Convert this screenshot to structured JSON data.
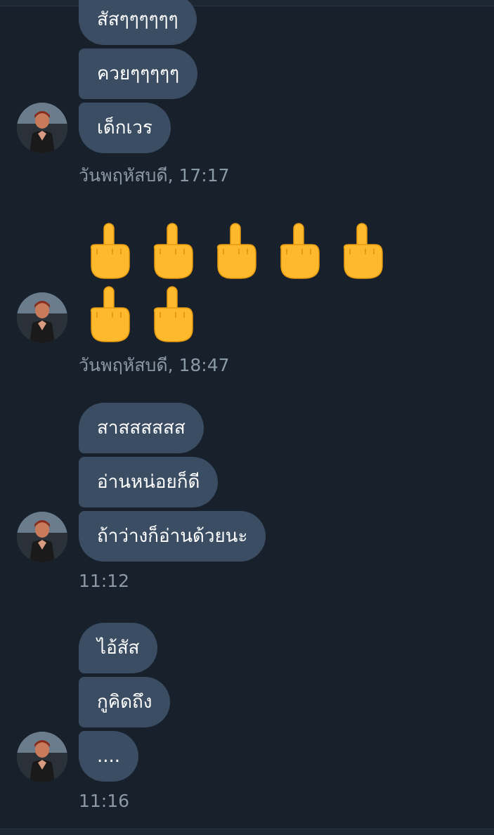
{
  "conversation": {
    "groups": [
      {
        "messages": [
          "สัสๆๆๆๆๆๆ",
          "ควยๆๆๆๆๆ",
          "เด็กเวร"
        ],
        "timestamp": "วันพฤหัสบดี, 17:17"
      },
      {
        "emoji": "🖕",
        "emoji_name": "middle-finger",
        "emoji_count": 7,
        "timestamp": "วันพฤหัสบดี, 18:47"
      },
      {
        "messages": [
          "สาสสสสสส",
          "อ่านหน่อยก็ดี",
          "ถ้าว่างก็อ่านด้วยนะ"
        ],
        "timestamp": "11:12"
      },
      {
        "messages": [
          "ไอ้สัส",
          "กูคิดถึง",
          "...."
        ],
        "timestamp": "11:16"
      }
    ]
  },
  "colors": {
    "background": "#17202b",
    "bubble": "#3b4d62",
    "timestamp": "#8b98a5",
    "emoji": "#ffb92c"
  },
  "icons": {
    "avatar": "user-avatar-photo"
  }
}
